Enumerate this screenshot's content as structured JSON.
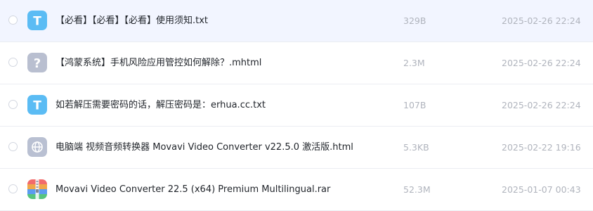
{
  "files": [
    {
      "name": "【必看】【必看】【必看】使用须知.txt",
      "size": "329B",
      "date": "2025-02-26 22:24",
      "icon": "text-file-icon",
      "icon_letter": "T",
      "icon_color": "#5bbcf4",
      "selected": true
    },
    {
      "name": "【鸿蒙系统】手机风险应用管控如何解除？.mhtml",
      "size": "2.3M",
      "date": "2025-02-26 22:24",
      "icon": "unknown-file-icon",
      "icon_letter": "?",
      "icon_color": "#b9bfd0",
      "selected": false
    },
    {
      "name": "如若解压需要密码的话，解压密码是：erhua.cc.txt",
      "size": "107B",
      "date": "2025-02-26 22:24",
      "icon": "text-file-icon",
      "icon_letter": "T",
      "icon_color": "#5bbcf4",
      "selected": false
    },
    {
      "name": "电脑端 视频音频转换器 Movavi Video Converter v22.5.0 激活版.html",
      "size": "5.3KB",
      "date": "2025-02-22 19:16",
      "icon": "web-file-icon",
      "icon_letter": "",
      "icon_color": "#b9c0d2",
      "selected": false
    },
    {
      "name": "Movavi Video Converter 22.5 (x64) Premium Multilingual.rar",
      "size": "52.3M",
      "date": "2025-01-07 00:43",
      "icon": "archive-file-icon",
      "icon_letter": "",
      "icon_color": "#f0a64a",
      "selected": false
    }
  ]
}
